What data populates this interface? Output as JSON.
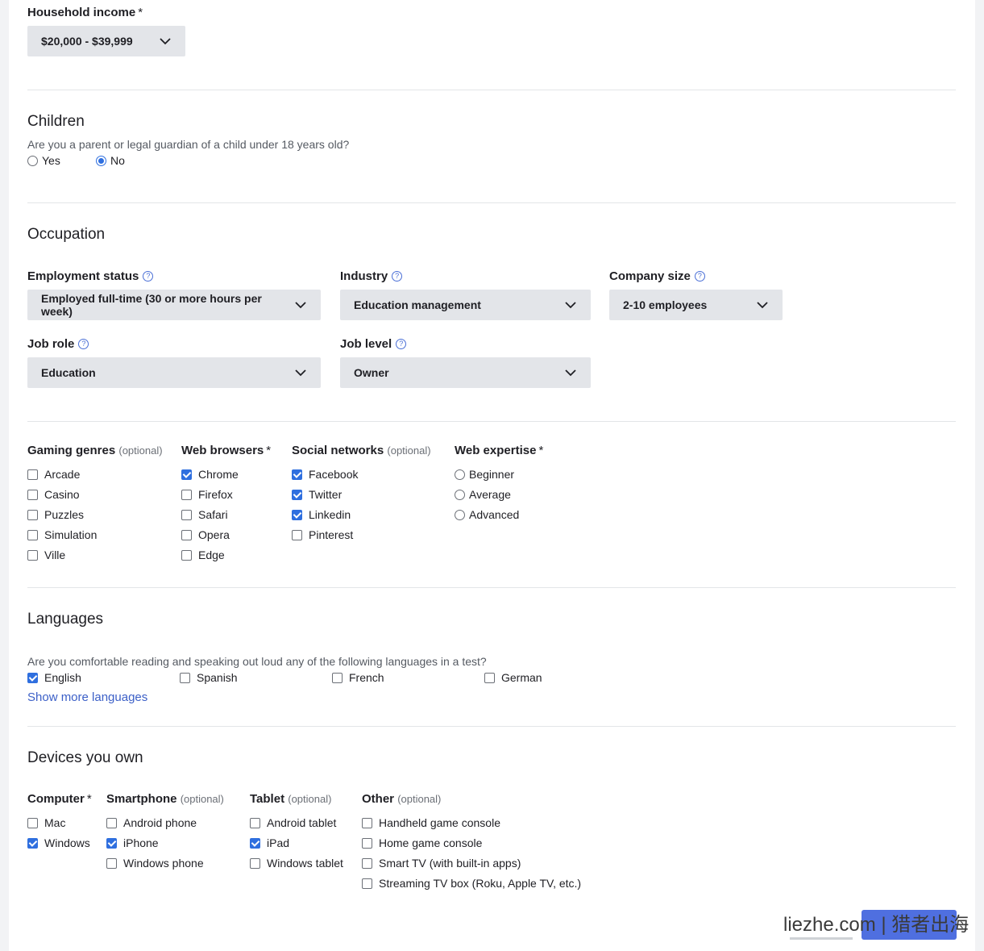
{
  "household": {
    "label": "Household income",
    "required_mark": "*",
    "value": "$20,000 - $39,999"
  },
  "children": {
    "title": "Children",
    "question": "Are you a parent or legal guardian of a child under 18 years old?",
    "options": [
      {
        "label": "Yes",
        "selected": false
      },
      {
        "label": "No",
        "selected": true
      }
    ]
  },
  "occupation": {
    "title": "Occupation",
    "employment": {
      "label": "Employment status",
      "value": "Employed full-time (30 or more hours per week)"
    },
    "industry": {
      "label": "Industry",
      "value": "Education management"
    },
    "company_size": {
      "label": "Company size",
      "value": "2-10 employees"
    },
    "job_role": {
      "label": "Job role",
      "value": "Education"
    },
    "job_level": {
      "label": "Job level",
      "value": "Owner"
    }
  },
  "help_glyph": "?",
  "optional_text": "(optional)",
  "interests": {
    "gaming": {
      "label": "Gaming genres",
      "items": [
        {
          "label": "Arcade",
          "checked": false
        },
        {
          "label": "Casino",
          "checked": false
        },
        {
          "label": "Puzzles",
          "checked": false
        },
        {
          "label": "Simulation",
          "checked": false
        },
        {
          "label": "Ville",
          "checked": false
        }
      ]
    },
    "browsers": {
      "label": "Web browsers",
      "required_mark": "*",
      "items": [
        {
          "label": "Chrome",
          "checked": true
        },
        {
          "label": "Firefox",
          "checked": false
        },
        {
          "label": "Safari",
          "checked": false
        },
        {
          "label": "Opera",
          "checked": false
        },
        {
          "label": "Edge",
          "checked": false
        }
      ]
    },
    "social": {
      "label": "Social networks",
      "items": [
        {
          "label": "Facebook",
          "checked": true
        },
        {
          "label": "Twitter",
          "checked": true
        },
        {
          "label": "Linkedin",
          "checked": true
        },
        {
          "label": "Pinterest",
          "checked": false
        }
      ]
    },
    "expertise": {
      "label": "Web expertise",
      "required_mark": "*",
      "items": [
        {
          "label": "Beginner",
          "selected": false
        },
        {
          "label": "Average",
          "selected": false
        },
        {
          "label": "Advanced",
          "selected": false
        }
      ]
    }
  },
  "languages": {
    "title": "Languages",
    "question": "Are you comfortable reading and speaking out loud any of the following languages in a test?",
    "items": [
      {
        "label": "English",
        "checked": true
      },
      {
        "label": "Spanish",
        "checked": false
      },
      {
        "label": "French",
        "checked": false
      },
      {
        "label": "German",
        "checked": false
      }
    ],
    "show_more": "Show more languages"
  },
  "devices": {
    "title": "Devices you own",
    "computer": {
      "label": "Computer",
      "required_mark": "*",
      "items": [
        {
          "label": "Mac",
          "checked": false
        },
        {
          "label": "Windows",
          "checked": true
        }
      ]
    },
    "smartphone": {
      "label": "Smartphone",
      "items": [
        {
          "label": "Android phone",
          "checked": false
        },
        {
          "label": "iPhone",
          "checked": true
        },
        {
          "label": "Windows phone",
          "checked": false
        }
      ]
    },
    "tablet": {
      "label": "Tablet",
      "items": [
        {
          "label": "Android tablet",
          "checked": false
        },
        {
          "label": "iPad",
          "checked": true
        },
        {
          "label": "Windows tablet",
          "checked": false
        }
      ]
    },
    "other": {
      "label": "Other",
      "items": [
        {
          "label": "Handheld game console",
          "checked": false
        },
        {
          "label": "Home game console",
          "checked": false
        },
        {
          "label": "Smart TV (with built-in apps)",
          "checked": false
        },
        {
          "label": "Streaming TV box (Roku, Apple TV, etc.)",
          "checked": false
        }
      ]
    }
  },
  "watermark": "liezhe.com | 猎者出海"
}
